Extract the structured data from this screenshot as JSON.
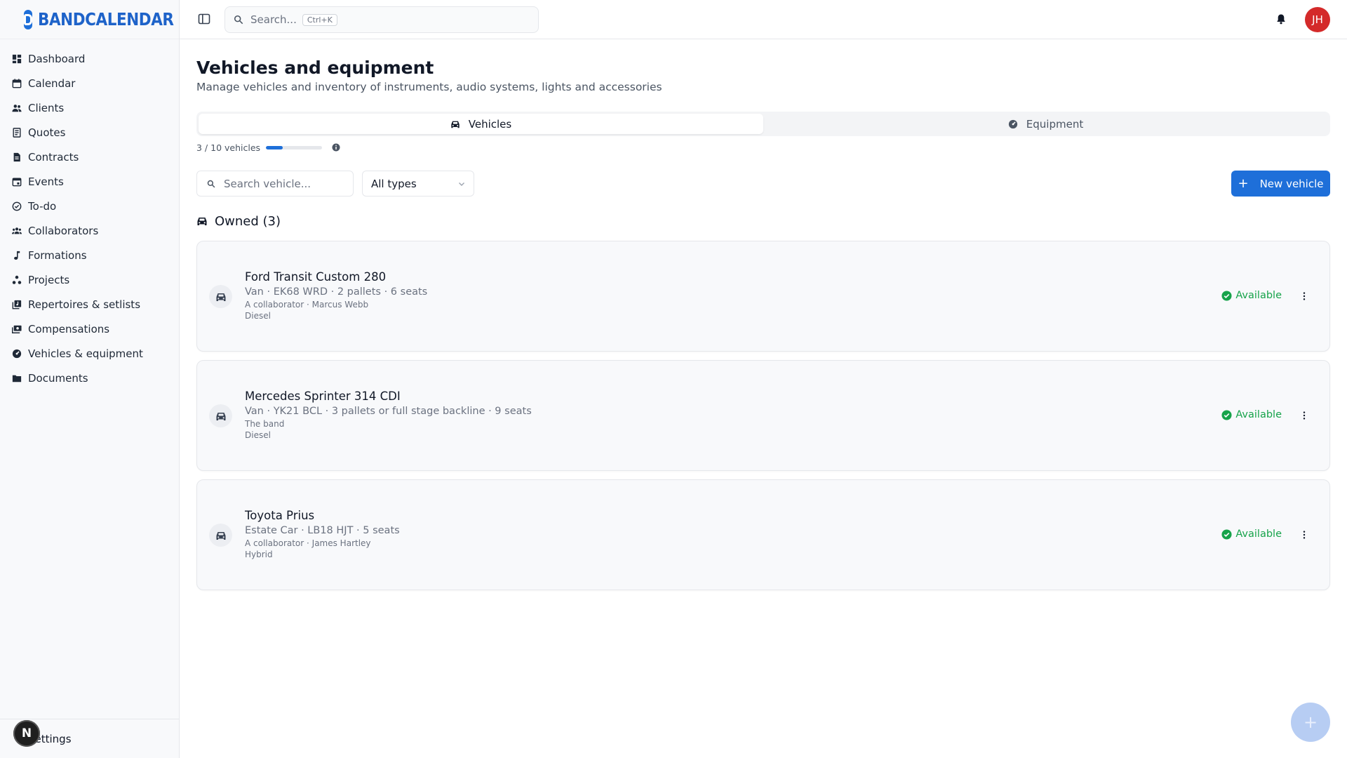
{
  "app": {
    "logo_text_a": "BAND",
    "logo_text_b": "CALENDAR"
  },
  "topbar": {
    "search_placeholder": "Search...",
    "search_shortcut": "Ctrl+K",
    "avatar_initials": "JH"
  },
  "sidebar": {
    "items": [
      {
        "label": "Dashboard",
        "icon": "dashboard-icon"
      },
      {
        "label": "Calendar",
        "icon": "calendar-icon"
      },
      {
        "label": "Clients",
        "icon": "clients-icon"
      },
      {
        "label": "Quotes",
        "icon": "quotes-icon"
      },
      {
        "label": "Contracts",
        "icon": "contracts-icon"
      },
      {
        "label": "Events",
        "icon": "events-icon"
      },
      {
        "label": "To-do",
        "icon": "todo-icon"
      },
      {
        "label": "Collaborators",
        "icon": "collaborators-icon"
      },
      {
        "label": "Formations",
        "icon": "music-note-icon"
      },
      {
        "label": "Projects",
        "icon": "projects-icon"
      },
      {
        "label": "Repertoires & setlists",
        "icon": "repertoire-icon"
      },
      {
        "label": "Compensations",
        "icon": "compensations-icon"
      },
      {
        "label": "Vehicles & equipment",
        "icon": "vehicles-icon"
      },
      {
        "label": "Documents",
        "icon": "folder-icon"
      }
    ],
    "settings_label": "Settings",
    "n_badge": "N"
  },
  "page": {
    "title": "Vehicles and equipment",
    "subtitle": "Manage vehicles and inventory of instruments, audio systems, lights and accessories"
  },
  "tabs": {
    "vehicles": "Vehicles",
    "equipment": "Equipment",
    "active": "Vehicles"
  },
  "quota": {
    "label": "3 / 10 vehicles",
    "fraction": 0.3
  },
  "toolbar": {
    "search_placeholder": "Search vehicle...",
    "type_filter": "All types",
    "new_button": "New vehicle"
  },
  "section": {
    "title": "Owned (3)"
  },
  "vehicles": [
    {
      "name": "Ford Transit Custom 280",
      "meta": "Van · EK68 WRD · 2 pallets · 6 seats",
      "owner": "A collaborator · Marcus Webb",
      "fuel": "Diesel",
      "status": "Available"
    },
    {
      "name": "Mercedes Sprinter 314 CDI",
      "meta": "Van · YK21 BCL · 3 pallets or full stage backline · 9 seats",
      "owner": "The band",
      "fuel": "Diesel",
      "status": "Available"
    },
    {
      "name": "Toyota Prius",
      "meta": "Estate Car · LB18 HJT · 5 seats",
      "owner": "A collaborator · James Hartley",
      "fuel": "Hybrid",
      "status": "Available"
    }
  ],
  "colors": {
    "accent": "#1e6fd9",
    "available": "#16a34a",
    "avatar": "#d42a2a",
    "logo_blue": "#1e63c9"
  }
}
